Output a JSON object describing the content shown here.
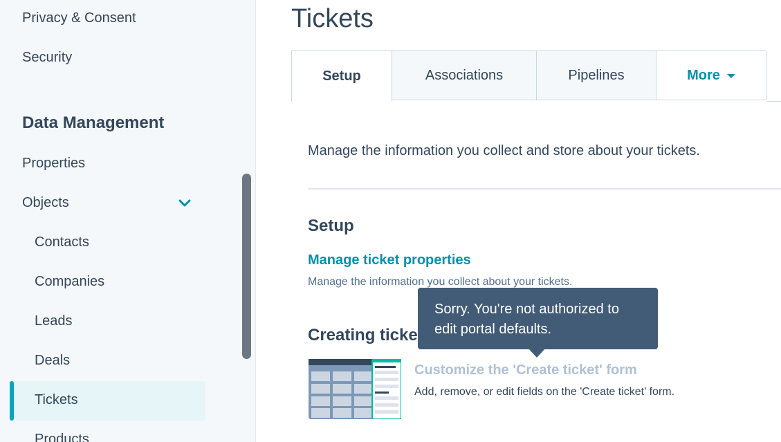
{
  "sidebar": {
    "items_top": [
      "Privacy & Consent",
      "Security"
    ],
    "heading": "Data Management",
    "properties": "Properties",
    "objects": "Objects",
    "objects_children": [
      "Contacts",
      "Companies",
      "Leads",
      "Deals",
      "Tickets",
      "Products"
    ],
    "active": "Tickets"
  },
  "main": {
    "title": "Tickets",
    "tabs": [
      {
        "label": "Setup",
        "active": true
      },
      {
        "label": "Associations",
        "active": false
      },
      {
        "label": "Pipelines",
        "active": false
      },
      {
        "label": "More",
        "active": false
      }
    ],
    "description": "Manage the information you collect and store about your tickets.",
    "setup_title": "Setup",
    "manage_link": "Manage ticket properties",
    "manage_desc": "Manage the information you collect about your tickets.",
    "creating_title": "Creating tickets",
    "customize_link": "Customize the 'Create ticket' form",
    "customize_desc": "Add, remove, or edit fields on the 'Create ticket' form."
  },
  "tooltip": {
    "text": "Sorry. You're not authorized to edit portal defaults."
  },
  "colors": {
    "accent": "#00a4bd",
    "link": "#0091ae",
    "tooltip_bg": "#425b76",
    "sidebar_bg": "#f5f8fa"
  }
}
